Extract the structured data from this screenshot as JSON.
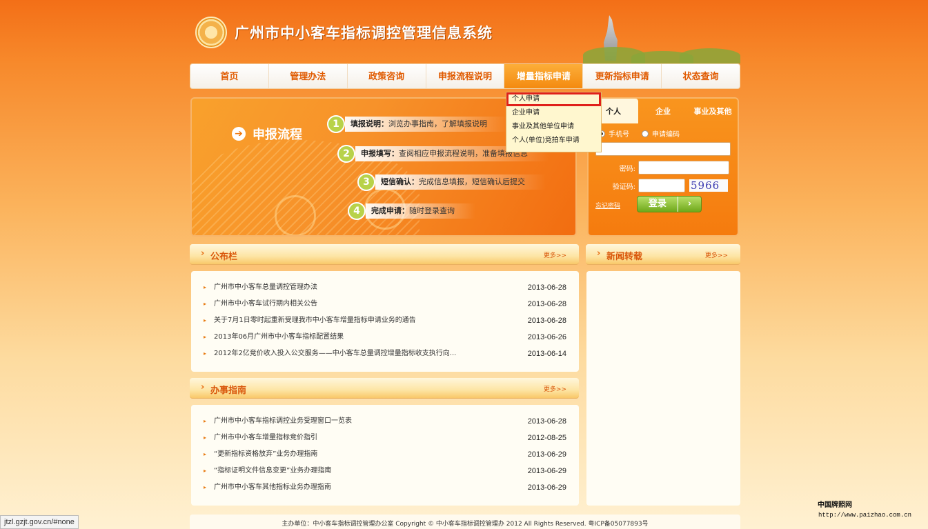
{
  "header": {
    "title": "广州市中小客车指标调控管理信息系统"
  },
  "nav": {
    "items": [
      "首页",
      "管理办法",
      "政策咨询",
      "申报流程说明",
      "增量指标申请",
      "更新指标申请",
      "状态查询"
    ],
    "active_index": 4
  },
  "dropdown": {
    "items": [
      "个人申请",
      "企业申请",
      "事业及其他单位申请",
      "个人(单位)竞拍车申请"
    ],
    "highlighted_index": 0
  },
  "banner": {
    "title": "申报流程",
    "steps": [
      {
        "num": "1",
        "label": "填报说明：",
        "text": "浏览办事指南，了解填报说明"
      },
      {
        "num": "2",
        "label": "申报填写：",
        "text": "查阅相应申报流程说明，准备填报信息"
      },
      {
        "num": "3",
        "label": "短信确认：",
        "text": "完成信息填报，短信确认后提交"
      },
      {
        "num": "4",
        "label": "完成申请：",
        "text": "随时登录查询"
      }
    ]
  },
  "login": {
    "tabs": [
      "个人",
      "企业",
      "事业及其他"
    ],
    "active_tab": 0,
    "radio_options": [
      "手机号",
      "申请编码"
    ],
    "password_label": "密码:",
    "captcha_label": "验证码:",
    "captcha_text": "5966",
    "forgot_label": "忘记密码",
    "login_button": "登录",
    "login_arrow": "›"
  },
  "bulletin": {
    "title": "公布栏",
    "more": "更多>>",
    "items": [
      {
        "title": "广州市中小客车总量调控管理办法",
        "date": "2013-06-28"
      },
      {
        "title": "广州市中小客车试行期内相关公告",
        "date": "2013-06-28"
      },
      {
        "title": "关于7月1日零时起重新受理我市中小客车增量指标申请业务的通告",
        "date": "2013-06-28"
      },
      {
        "title": "2013年06月广州市中小客车指标配置结果",
        "date": "2013-06-26"
      },
      {
        "title": "2012年2亿竞价收入投入公交服务——中小客车总量调控增量指标收支执行向...",
        "date": "2013-06-14"
      }
    ]
  },
  "guide": {
    "title": "办事指南",
    "more": "更多>>",
    "items": [
      {
        "title": "广州市中小客车指标调控业务受理窗口一览表",
        "date": "2013-06-28"
      },
      {
        "title": "广州市中小客车增量指标竞价指引",
        "date": "2012-08-25"
      },
      {
        "title": "“更新指标资格放弃”业务办理指南",
        "date": "2013-06-29"
      },
      {
        "title": "“指标证明文件信息变更”业务办理指南",
        "date": "2013-06-29"
      },
      {
        "title": "广州市中小客车其他指标业务办理指南",
        "date": "2013-06-29"
      }
    ]
  },
  "newsfeed": {
    "title": "新闻转载",
    "more": "更多>>"
  },
  "footer": {
    "text": "主办单位：中小客车指标调控管理办公室  Copyright ©  中小客车指标调控管理办    2012  All Rights Reserved.  粤ICP备05077893号"
  },
  "statusbar": {
    "url": "jtzl.gzjt.gov.cn/#none"
  },
  "watermark": {
    "line1": "中国牌照网",
    "line2": "http://www.paizhao.com.cn"
  }
}
